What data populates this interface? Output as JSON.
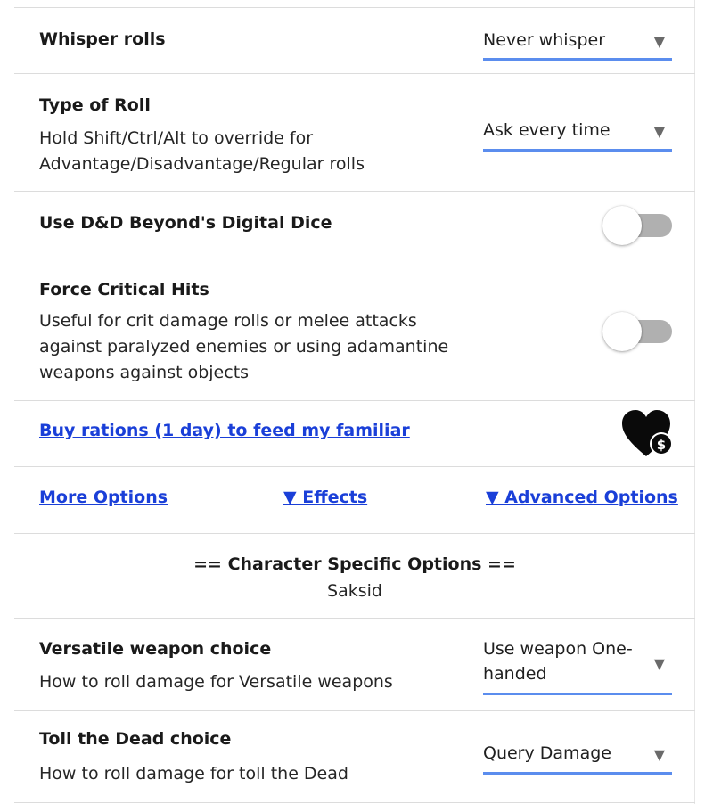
{
  "whisper": {
    "title": "Whisper rolls",
    "value": "Never whisper",
    "arrow": "▼"
  },
  "roll_type": {
    "title": "Type of Roll",
    "desc_line1": "Hold Shift/Ctrl/Alt to override for",
    "desc_line2": "Advantage/Disadvantage/Regular rolls",
    "value": "Ask every time",
    "arrow": "▼"
  },
  "digital_dice": {
    "title": "Use D&D Beyond's Digital Dice",
    "enabled": false
  },
  "force_crit": {
    "title": "Force Critical Hits",
    "desc_line1": "Useful for crit damage rolls or melee attacks",
    "desc_line2": "against paralyzed enemies or using adamantine",
    "desc_line3": "weapons against objects",
    "enabled": false
  },
  "donate": {
    "link": "Buy rations (1 day) to feed my familiar",
    "icon": "heart-dollar-icon"
  },
  "options_links": {
    "more": "More Options",
    "effects": "▼ Effects",
    "advanced": "▼ Advanced Options"
  },
  "character_section": {
    "title": "== Character Specific Options ==",
    "name": "Saksid"
  },
  "versatile": {
    "title": "Versatile weapon choice",
    "desc": "How to roll damage for Versatile weapons",
    "value_line1": "Use weapon One-",
    "value_line2": "handed",
    "arrow": "▼"
  },
  "toll_dead": {
    "title": "Toll the Dead choice",
    "desc": "How to roll damage for toll the Dead",
    "value": "Query Damage",
    "arrow": "▼"
  },
  "colors": {
    "accent_underline": "#5b8dee",
    "link": "#1a3fd8",
    "toggle_track_off": "#b0b0b0"
  }
}
